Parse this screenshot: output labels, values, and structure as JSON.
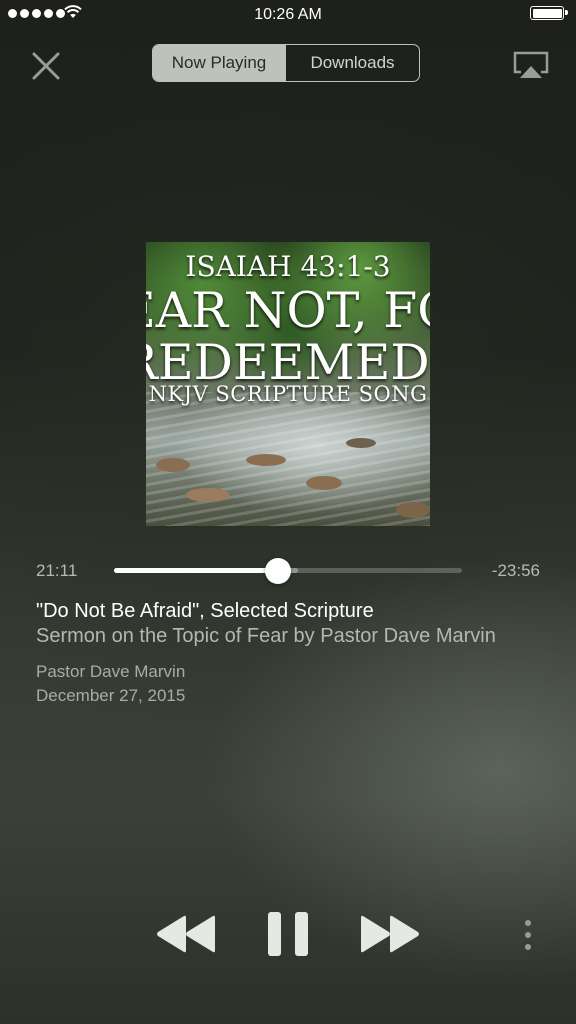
{
  "status_bar": {
    "time": "10:26 AM"
  },
  "tabs": [
    {
      "label": "Now Playing",
      "selected": true
    },
    {
      "label": "Downloads",
      "selected": false
    }
  ],
  "artwork": {
    "line1": "ISAIAH 43:1-3",
    "line2": "FEAR NOT, FOR",
    "line3": "I REDEEMED YOU",
    "line4": "NKJV SCRIPTURE SONG"
  },
  "progress": {
    "elapsed": "21:11",
    "remaining": "-23:56",
    "fraction": 0.47,
    "buffered": 0.53
  },
  "track": {
    "title": "\"Do Not Be Afraid\", Selected Scripture",
    "subtitle": "Sermon on the Topic of Fear by Pastor Dave Marvin",
    "speaker": "Pastor Dave Marvin",
    "date": "December 27, 2015"
  },
  "icons": {
    "close": "close-icon",
    "airplay": "airplay-icon",
    "rewind": "rewind-icon",
    "pause": "pause-icon",
    "forward": "fast-forward-icon",
    "more": "more-vertical-icon"
  }
}
